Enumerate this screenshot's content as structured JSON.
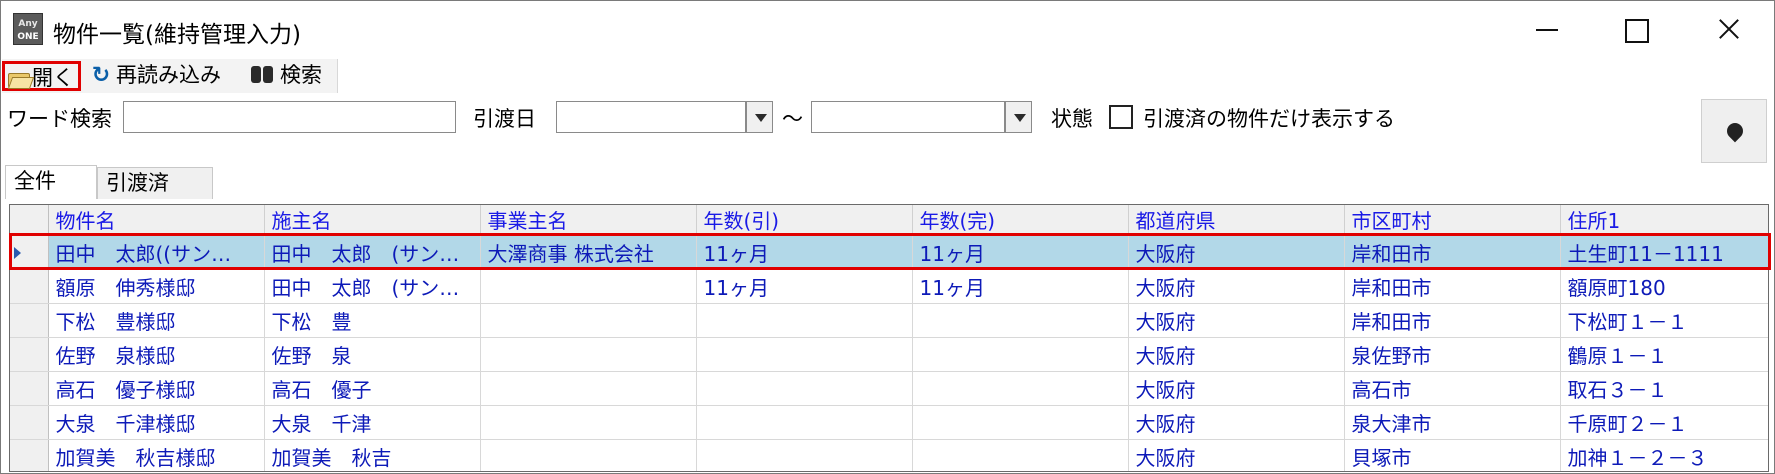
{
  "window": {
    "app_icon": {
      "top": "Any",
      "bottom": "ONE"
    },
    "title": "物件一覧(維持管理入力)"
  },
  "toolbar": {
    "open_label": "開く",
    "reload_label": "再読み込み",
    "search_label": "検索"
  },
  "filters": {
    "word_search_label": "ワード検索",
    "word_search_value": "",
    "delivery_date_label": "引渡日",
    "date_from": "",
    "tilde": "～",
    "date_to": "",
    "status_label": "状態",
    "delivered_only_label": "引渡済の物件だけ表示する",
    "delivered_only_checked": false
  },
  "tabs": [
    {
      "label": "全件",
      "active": true
    },
    {
      "label": "引渡済",
      "active": false
    }
  ],
  "grid": {
    "columns": [
      "物件名",
      "施主名",
      "事業主名",
      "年数(引)",
      "年数(完)",
      "都道府県",
      "市区町村",
      "住所1"
    ],
    "rows": [
      [
        "田中　太郎((サン…",
        "田中　太郎　(サン…",
        "大澤商事 株式会社",
        "11ヶ月",
        "11ヶ月",
        "大阪府",
        "岸和田市",
        "土生町11－1111"
      ],
      [
        "額原　伸秀様邸",
        "田中　太郎　(サン…",
        "",
        "11ヶ月",
        "11ヶ月",
        "大阪府",
        "岸和田市",
        "額原町180"
      ],
      [
        "下松　豊様邸",
        "下松　豊",
        "",
        "",
        "",
        "大阪府",
        "岸和田市",
        "下松町１－１"
      ],
      [
        "佐野　泉様邸",
        "佐野　泉",
        "",
        "",
        "",
        "大阪府",
        "泉佐野市",
        "鶴原１－１"
      ],
      [
        "高石　優子様邸",
        "高石　優子",
        "",
        "",
        "",
        "大阪府",
        "高石市",
        "取石３－１"
      ],
      [
        "大泉　千津様邸",
        "大泉　千津",
        "",
        "",
        "",
        "大阪府",
        "泉大津市",
        "千原町２－１"
      ],
      [
        "加賀美　秋吉様邸",
        "加賀美　秋吉",
        "",
        "",
        "",
        "大阪府",
        "貝塚市",
        "加神１－２－３"
      ]
    ],
    "selected_row": 0
  }
}
